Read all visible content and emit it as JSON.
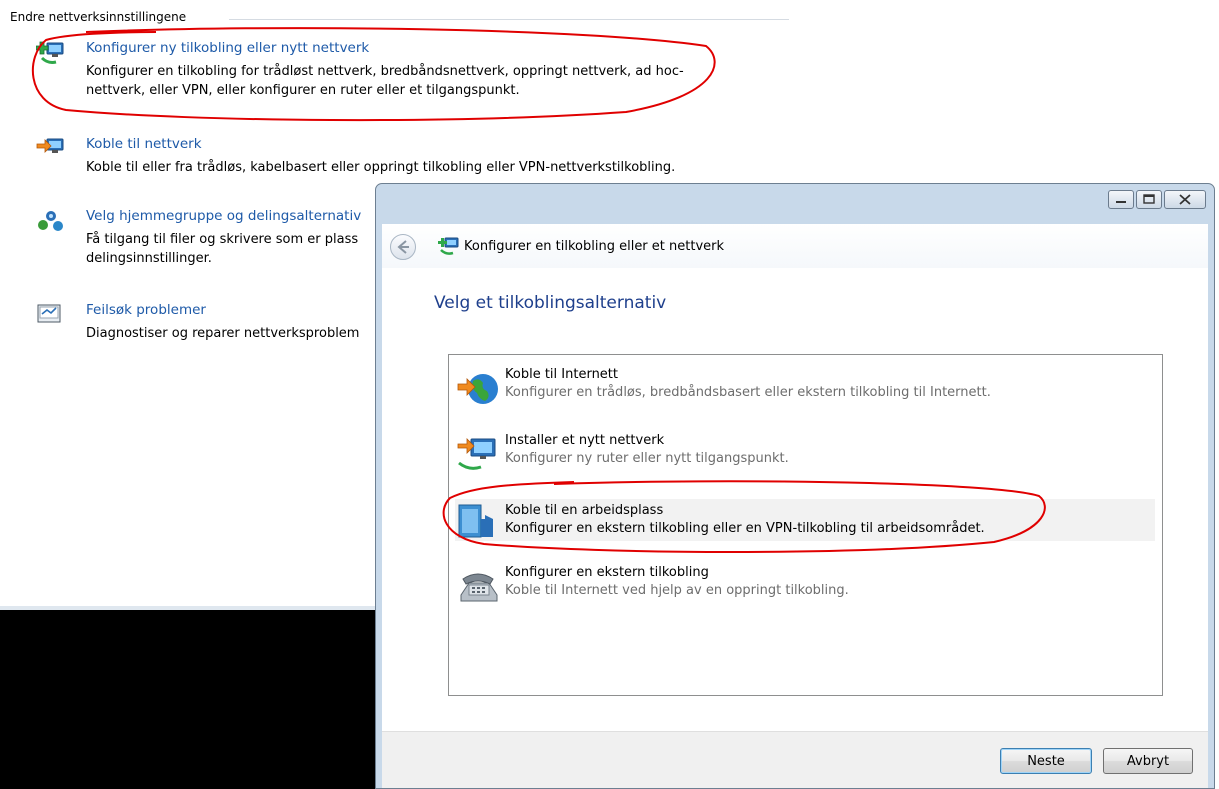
{
  "panel": {
    "section_title": "Endre nettverksinnstillingene",
    "tasks": [
      {
        "link": "Konfigurer ny tilkobling eller nytt nettverk",
        "desc": "Konfigurer en tilkobling for trådløst nettverk, bredbåndsnettverk, oppringt nettverk, ad hoc-nettverk, eller VPN, eller konfigurer en ruter eller et tilgangspunkt."
      },
      {
        "link": "Koble til nettverk",
        "desc": "Koble til eller fra trådløs, kabelbasert eller oppringt tilkobling eller VPN-nettverkstilkobling."
      },
      {
        "link": "Velg hjemmegruppe og delingsalternativ",
        "desc": "Få tilgang til filer og skrivere som er plass delingsinnstillinger."
      },
      {
        "link": "Feilsøk problemer",
        "desc": "Diagnostiser og reparer nettverksproblem"
      }
    ]
  },
  "dialog": {
    "title": "Konfigurer en tilkobling eller et nettverk",
    "heading": "Velg et tilkoblingsalternativ",
    "options": [
      {
        "title": "Koble til Internett",
        "desc": "Konfigurer en trådløs, bredbåndsbasert eller ekstern tilkobling til Internett."
      },
      {
        "title": "Installer et nytt nettverk",
        "desc": "Konfigurer ny ruter eller nytt tilgangspunkt."
      },
      {
        "title": "Koble til en arbeidsplass",
        "desc": "Konfigurer en ekstern tilkobling eller en VPN-tilkobling til arbeidsområdet."
      },
      {
        "title": "Konfigurer en ekstern tilkobling",
        "desc": "Koble til Internett ved hjelp av en oppringt tilkobling."
      }
    ],
    "next_label": "Neste",
    "cancel_label": "Avbryt"
  },
  "colors": {
    "link": "#1e5aa8",
    "heading": "#1e3f8c",
    "annotation": "#e00000"
  }
}
